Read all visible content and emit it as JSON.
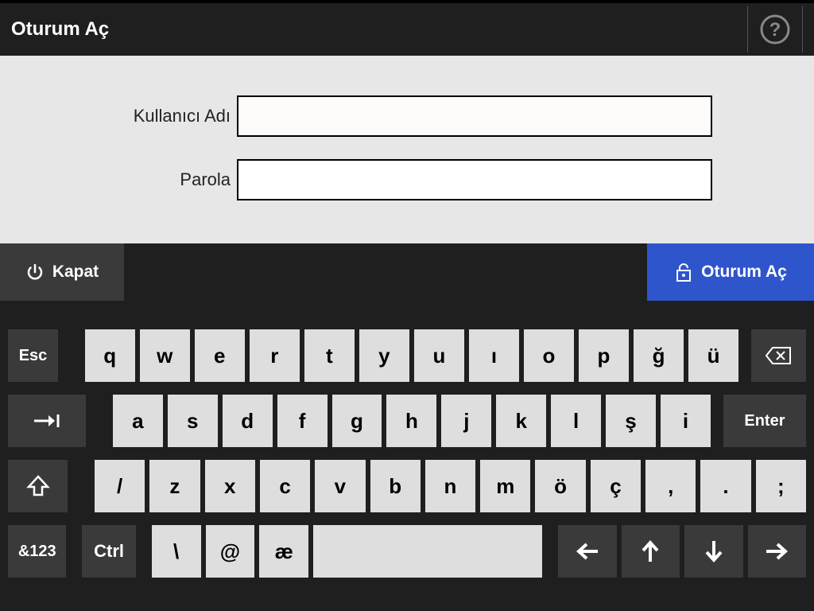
{
  "header": {
    "title": "Oturum Aç"
  },
  "form": {
    "username_label": "Kullanıcı Adı",
    "username_value": "",
    "password_label": "Parola",
    "password_value": ""
  },
  "actions": {
    "close_label": "Kapat",
    "login_label": "Oturum Aç"
  },
  "keyboard": {
    "row1": {
      "esc": "Esc",
      "keys": [
        "q",
        "w",
        "e",
        "r",
        "t",
        "y",
        "u",
        "ı",
        "o",
        "p",
        "ğ",
        "ü"
      ]
    },
    "row2": {
      "keys": [
        "a",
        "s",
        "d",
        "f",
        "g",
        "h",
        "j",
        "k",
        "l",
        "ş",
        "i"
      ],
      "enter": "Enter"
    },
    "row3": {
      "keys": [
        "/",
        "z",
        "x",
        "c",
        "v",
        "b",
        "n",
        "m",
        "ö",
        "ç",
        ",",
        ".",
        ";"
      ]
    },
    "row4": {
      "numsym": "&123",
      "ctrl": "Ctrl",
      "backslash": "\\",
      "at": "@",
      "ae": "æ"
    }
  }
}
